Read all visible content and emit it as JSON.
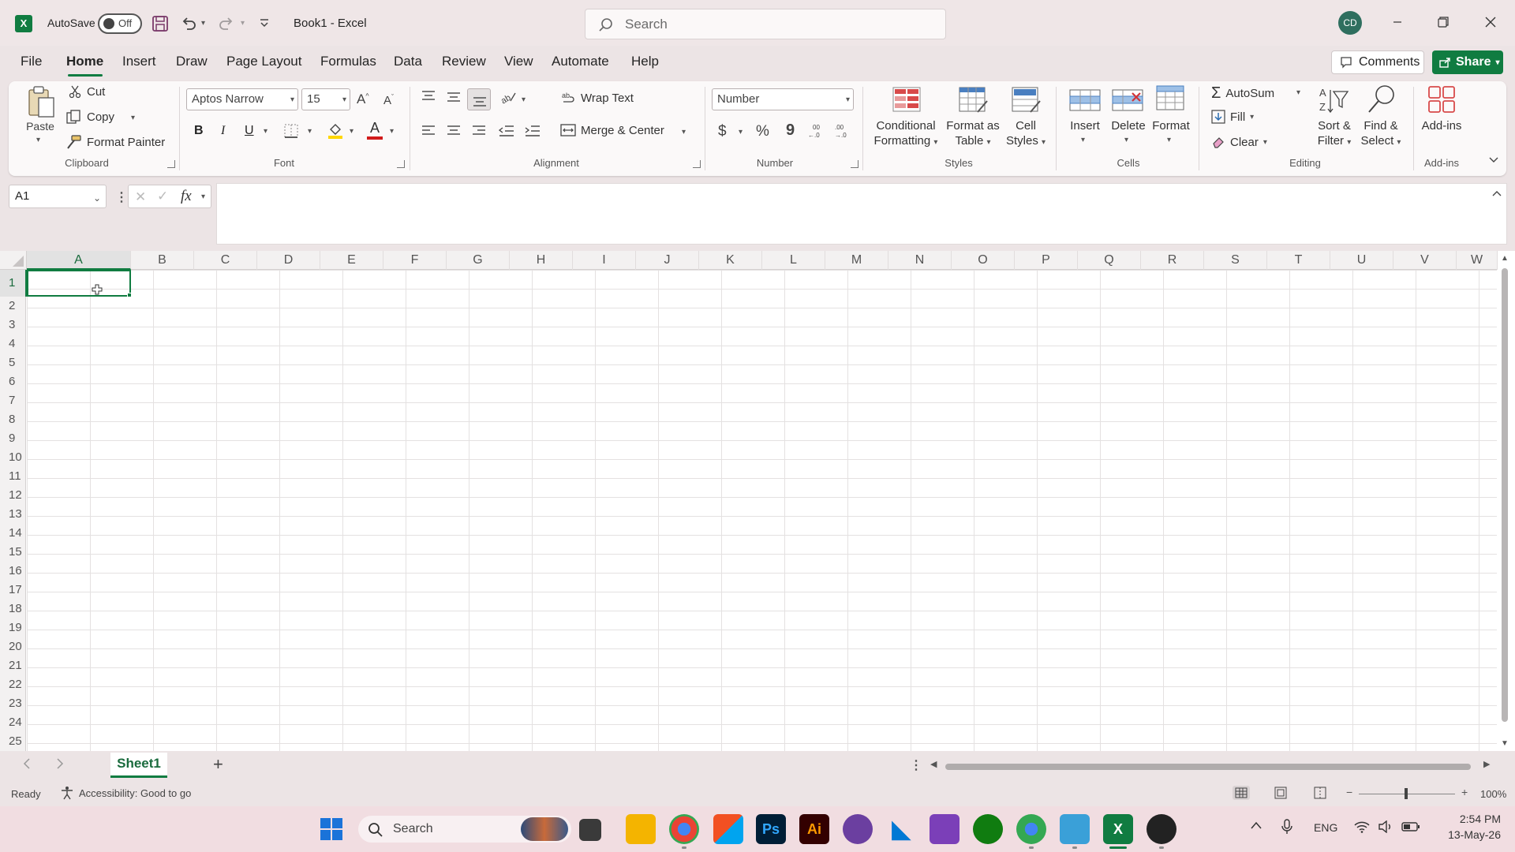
{
  "app": {
    "autosave_label": "AutoSave",
    "autosave_state": "Off",
    "doc_title": "Book1  -  Excel",
    "search_placeholder": "Search",
    "avatar_initials": "CD"
  },
  "menu": {
    "items": [
      "File",
      "Home",
      "Insert",
      "Draw",
      "Page Layout",
      "Formulas",
      "Data",
      "Review",
      "View",
      "Automate",
      "Help"
    ],
    "active": "Home",
    "comments_label": "Comments",
    "share_label": "Share"
  },
  "ribbon": {
    "clipboard": {
      "paste": "Paste",
      "cut": "Cut",
      "copy": "Copy",
      "format_painter": "Format Painter",
      "group": "Clipboard"
    },
    "font": {
      "name": "Aptos Narrow",
      "size": "15",
      "bold": "B",
      "italic": "I",
      "underline": "U",
      "font_color_letter": "A",
      "group": "Font"
    },
    "alignment": {
      "wrap_text": "Wrap Text",
      "merge_center": "Merge & Center",
      "group": "Alignment"
    },
    "number": {
      "format": "Number",
      "currency": "$",
      "percent": "%",
      "comma": "9",
      "group": "Number"
    },
    "styles": {
      "conditional_line1": "Conditional",
      "conditional_line2": "Formatting",
      "format_table_line1": "Format as",
      "format_table_line2": "Table",
      "cell_styles_line1": "Cell",
      "cell_styles_line2": "Styles",
      "group": "Styles"
    },
    "cells": {
      "insert": "Insert",
      "delete": "Delete",
      "format": "Format",
      "group": "Cells"
    },
    "editing": {
      "autosum": "AutoSum",
      "fill": "Fill",
      "clear": "Clear",
      "sort_line1": "Sort &",
      "sort_line2": "Filter",
      "find_line1": "Find &",
      "find_line2": "Select",
      "group": "Editing"
    },
    "addins": {
      "label": "Add-ins",
      "group": "Add-ins"
    }
  },
  "formula_bar": {
    "name_box": "A1",
    "fx": "fx",
    "content": ""
  },
  "grid": {
    "columns": [
      "A",
      "B",
      "C",
      "D",
      "E",
      "F",
      "G",
      "H",
      "I",
      "J",
      "K",
      "L",
      "M",
      "N",
      "O",
      "P",
      "Q",
      "R",
      "S",
      "T",
      "U",
      "V",
      "W"
    ],
    "rows": [
      "1",
      "2",
      "3",
      "4",
      "5",
      "6",
      "7",
      "8",
      "9",
      "10",
      "11",
      "12",
      "13",
      "14",
      "15",
      "16",
      "17",
      "18",
      "19",
      "20",
      "21",
      "22",
      "23",
      "24",
      "25"
    ],
    "selected_cell": "A1"
  },
  "sheets": {
    "tabs": [
      "Sheet1"
    ],
    "add": "+"
  },
  "status": {
    "ready": "Ready",
    "accessibility": "Accessibility: Good to go",
    "zoom": "100%"
  },
  "taskbar": {
    "search_placeholder": "Search",
    "lang": "ENG",
    "time": "2:54 PM",
    "date": "13-May-26"
  },
  "colors": {
    "accent": "#107c41",
    "ribbon_bg": "#fbf9f9",
    "title_bg": "#efe6e7"
  }
}
